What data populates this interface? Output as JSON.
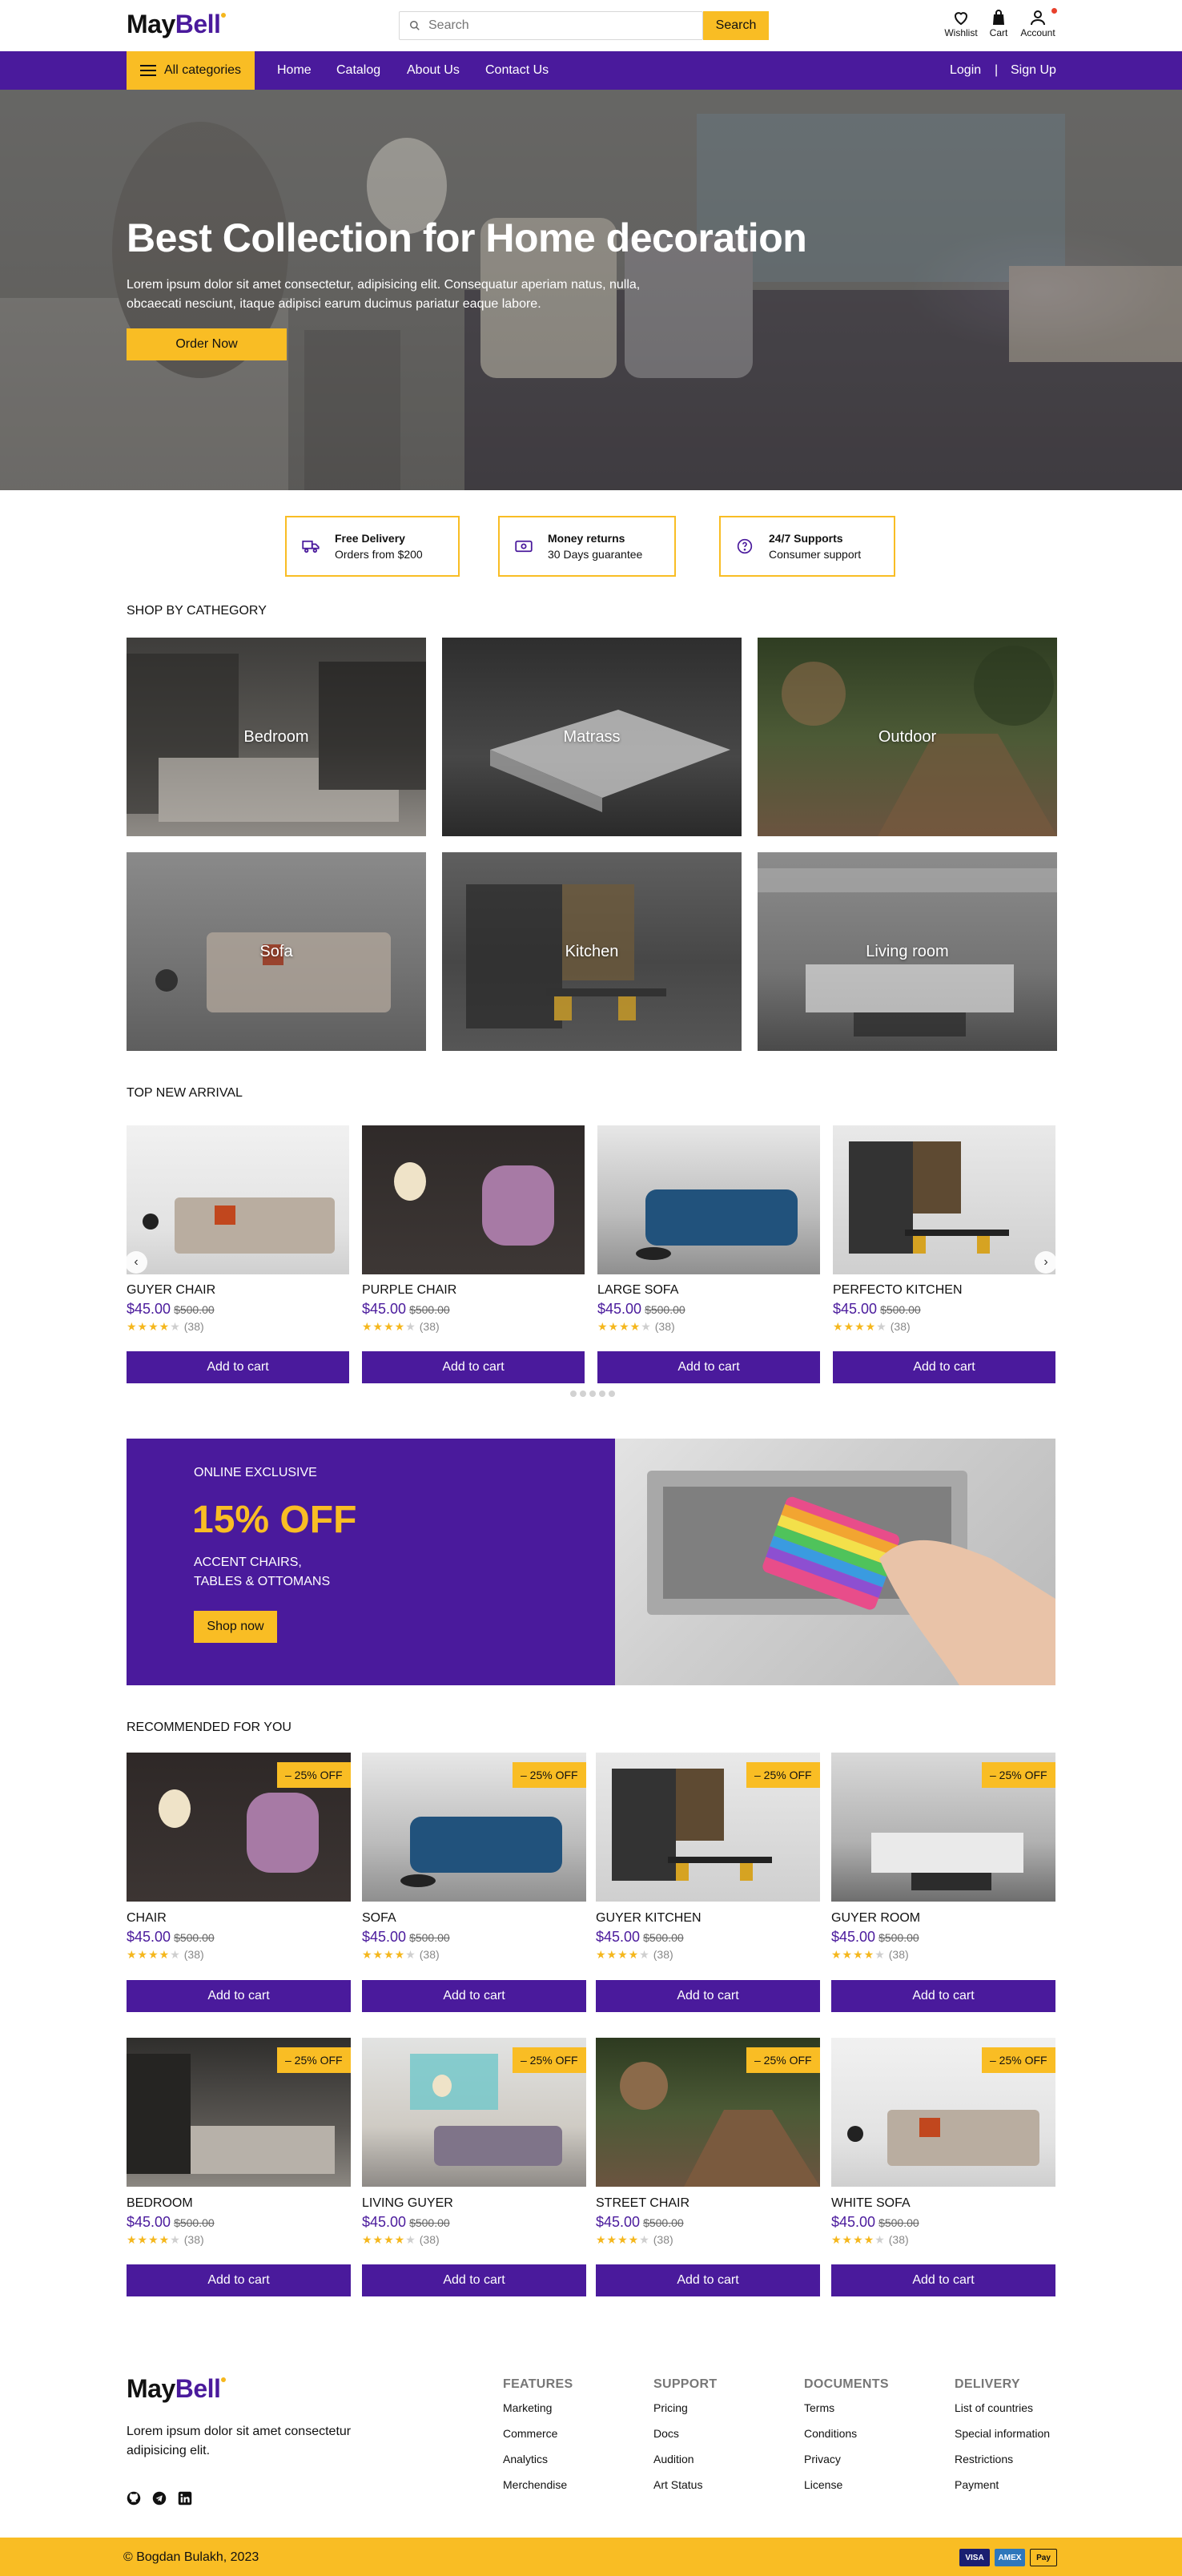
{
  "header": {
    "logo_part1": "May",
    "logo_part2": "Bell",
    "search_placeholder": "Search",
    "search_button": "Search",
    "wishlist": "Wishlist",
    "cart": "Cart",
    "account": "Account"
  },
  "nav": {
    "all_categories": "All categories",
    "links": [
      "Home",
      "Catalog",
      "About Us",
      "Contact Us"
    ],
    "login": "Login",
    "separator": "|",
    "signup": "Sign Up"
  },
  "hero": {
    "title": "Best Collection for Home decoration",
    "subtitle": "Lorem ipsum dolor sit amet consectetur, adipisicing elit. Consequatur aperiam natus, nulla, obcaecati nesciunt, itaque adipisci earum ducimus pariatur eaque labore.",
    "button": "Order Now"
  },
  "features": [
    {
      "icon": "truck-icon",
      "title": "Free Delivery",
      "sub": "Orders from $200"
    },
    {
      "icon": "money-icon",
      "title": "Money returns",
      "sub": "30 Days guarantee"
    },
    {
      "icon": "question-icon",
      "title": "24/7 Supports",
      "sub": "Consumer support"
    }
  ],
  "categories_title": "SHOP BY CATHEGORY",
  "categories": [
    "Bedroom",
    "Matrass",
    "Outdoor",
    "Sofa",
    "Kitchen",
    "Living room"
  ],
  "arrivals_title": "TOP NEW ARRIVAL",
  "arrivals": [
    {
      "name": "GUYER CHAIR",
      "price": "$45.00",
      "old": "$500.00",
      "reviews": "(38)",
      "rating": 4,
      "button": "Add to cart"
    },
    {
      "name": "PURPLE CHAIR",
      "price": "$45.00",
      "old": "$500.00",
      "reviews": "(38)",
      "rating": 4,
      "button": "Add to cart"
    },
    {
      "name": "LARGE SOFA",
      "price": "$45.00",
      "old": "$500.00",
      "reviews": "(38)",
      "rating": 4,
      "button": "Add to cart"
    },
    {
      "name": "PERFECTO KITCHEN",
      "price": "$45.00",
      "old": "$500.00",
      "reviews": "(38)",
      "rating": 4,
      "button": "Add to cart"
    }
  ],
  "carousel": {
    "prev": "‹",
    "next": "›",
    "pages": 5
  },
  "promo": {
    "label": "ONLINE EXCLUSIVE",
    "headline": "15% OFF",
    "line1": "ACCENT CHAIRS,",
    "line2": "TABLES & OTTOMANS",
    "button": "Shop now"
  },
  "recommended_title": "RECOMMENDED FOR YOU",
  "recommended": [
    {
      "name": "CHAIR",
      "price": "$45.00",
      "old": "$500.00",
      "reviews": "(38)",
      "rating": 4,
      "discount": "– 25% OFF",
      "button": "Add to cart"
    },
    {
      "name": "SOFA",
      "price": "$45.00",
      "old": "$500.00",
      "reviews": "(38)",
      "rating": 4,
      "discount": "– 25% OFF",
      "button": "Add to cart"
    },
    {
      "name": "GUYER KITCHEN",
      "price": "$45.00",
      "old": "$500.00",
      "reviews": "(38)",
      "rating": 4,
      "discount": "– 25% OFF",
      "button": "Add to cart"
    },
    {
      "name": "GUYER ROOM",
      "price": "$45.00",
      "old": "$500.00",
      "reviews": "(38)",
      "rating": 4,
      "discount": "– 25% OFF",
      "button": "Add to cart"
    },
    {
      "name": "BEDROOM",
      "price": "$45.00",
      "old": "$500.00",
      "reviews": "(38)",
      "rating": 4,
      "discount": "– 25% OFF",
      "button": "Add to cart"
    },
    {
      "name": "LIVING GUYER",
      "price": "$45.00",
      "old": "$500.00",
      "reviews": "(38)",
      "rating": 4,
      "discount": "– 25% OFF",
      "button": "Add to cart"
    },
    {
      "name": "STREET CHAIR",
      "price": "$45.00",
      "old": "$500.00",
      "reviews": "(38)",
      "rating": 4,
      "discount": "– 25% OFF",
      "button": "Add to cart"
    },
    {
      "name": "WHITE SOFA",
      "price": "$45.00",
      "old": "$500.00",
      "reviews": "(38)",
      "rating": 4,
      "discount": "– 25% OFF",
      "button": "Add to cart"
    }
  ],
  "footer": {
    "description": "Lorem ipsum dolor sit amet consectetur adipisicing elit.",
    "columns": [
      {
        "title": "FEATURES",
        "links": [
          "Marketing",
          "Commerce",
          "Analytics",
          "Merchendise"
        ]
      },
      {
        "title": "SUPPORT",
        "links": [
          "Pricing",
          "Docs",
          "Audition",
          "Art Status"
        ]
      },
      {
        "title": "DOCUMENTS",
        "links": [
          "Terms",
          "Conditions",
          "Privacy",
          "License"
        ]
      },
      {
        "title": "DELIVERY",
        "links": [
          "List of countries",
          "Special information",
          "Restrictions",
          "Payment"
        ]
      }
    ],
    "socials": [
      "github-icon",
      "telegram-icon",
      "linkedin-icon"
    ],
    "copyright": "© Bogdan Bulakh, 2023",
    "payments": [
      "VISA",
      "AMEX",
      "Pay"
    ]
  },
  "colors": {
    "purple": "#4a1a9c",
    "yellow": "#f9bd24",
    "notification": "#e8412c"
  }
}
